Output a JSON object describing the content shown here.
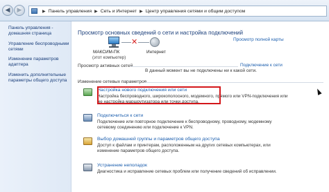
{
  "address_bar": {
    "crumbs": [
      "Панель управления",
      "Сеть и Интернет",
      "Центр управления сетями и общим доступом"
    ]
  },
  "sidebar": {
    "items": [
      {
        "label": "Панель управления - домашняя страница"
      },
      {
        "label": "Управление беспроводными сетями"
      },
      {
        "label": "Изменение параметров адаптера"
      },
      {
        "label": "Изменить дополнительные параметры общего доступа"
      }
    ]
  },
  "main": {
    "title": "Просмотр основных сведений о сети и настройка подключений",
    "full_map_link": "Просмотр полной карты",
    "network_map": {
      "computer_name": "МАКСИМ-ПК",
      "computer_sub": "(этот компьютер)",
      "internet_label": "Интернет"
    },
    "active_networks": {
      "label": "Просмотр активных сетей",
      "status": "В данный момент вы не подключены ни к какой сети.",
      "connect_link": "Подключение к сети"
    },
    "change_settings_label": "Изменение сетевых параметров",
    "tasks": [
      {
        "title": "Настройка нового подключения или сети",
        "desc": "Настройка беспроводного, широкополосного, модемного, прямого или VPN-подключения или же настройка маршрутизатора или точки доступа."
      },
      {
        "title": "Подключиться к сети",
        "desc": "Подключение или повторное подключение к беспроводному, проводному, модемному сетевому соединению или подключение к VPN."
      },
      {
        "title": "Выбор домашней группы и параметров общего доступа",
        "desc": "Доступ к файлам и принтерам, расположенным на других сетевых компьютерах, или изменение параметров общего доступа."
      },
      {
        "title": "Устранение неполадок",
        "desc": "Диагностика и исправление сетевых проблем или получение сведений об исправлении."
      }
    ]
  },
  "colors": {
    "link": "#1a5dad",
    "highlight": "#d3161a",
    "disconnected": "#d6201f"
  }
}
